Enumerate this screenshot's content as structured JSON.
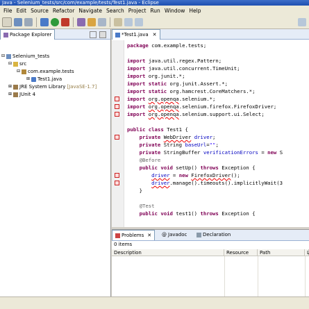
{
  "window": {
    "title": "Java - Selenium_tests/src/com/example/tests/Test1.java - Eclipse"
  },
  "menu": [
    "File",
    "Edit",
    "Source",
    "Refactor",
    "Navigate",
    "Search",
    "Project",
    "Run",
    "Window",
    "Help"
  ],
  "package_explorer": {
    "tab_label": "Package Explorer",
    "tree": [
      {
        "label": "Selenium_tests"
      },
      {
        "label": "src"
      },
      {
        "label": "com.example.tests"
      },
      {
        "label": "Test1.java"
      },
      {
        "label": "JRE System Library",
        "extra": "[JavaSE-1.7]"
      },
      {
        "label": "JUnit 4"
      }
    ]
  },
  "editor": {
    "tab_label": "*Test1.java",
    "lines": [
      [
        {
          "t": "package",
          "c": "kw"
        },
        {
          "t": " com.example.tests;"
        }
      ],
      [],
      [
        {
          "t": "import",
          "c": "kw"
        },
        {
          "t": " java.util.regex.Pattern;"
        }
      ],
      [
        {
          "t": "import",
          "c": "kw"
        },
        {
          "t": " java.util.concurrent.TimeUnit;"
        }
      ],
      [
        {
          "t": "import",
          "c": "kw"
        },
        {
          "t": " org.junit.*;"
        }
      ],
      [
        {
          "t": "import static",
          "c": "kw"
        },
        {
          "t": " org.junit.Assert.*;"
        }
      ],
      [
        {
          "t": "import static",
          "c": "kw"
        },
        {
          "t": " org.hamcrest.CoreMatchers.*;"
        }
      ],
      [
        {
          "t": "import",
          "c": "kw"
        },
        {
          "t": " "
        },
        {
          "t": "org.openqa",
          "c": "err"
        },
        {
          "t": ".selenium.*;"
        }
      ],
      [
        {
          "t": "import",
          "c": "kw"
        },
        {
          "t": " "
        },
        {
          "t": "org.openqa",
          "c": "err"
        },
        {
          "t": ".selenium.firefox.FirefoxDriver;"
        }
      ],
      [
        {
          "t": "import",
          "c": "kw"
        },
        {
          "t": " "
        },
        {
          "t": "org.openqa",
          "c": "err"
        },
        {
          "t": ".selenium.support.ui.Select;"
        }
      ],
      [],
      [
        {
          "t": "public class",
          "c": "kw"
        },
        {
          "t": " Test1 {"
        }
      ],
      [
        {
          "t": "    private",
          "c": "kw"
        },
        {
          "t": " "
        },
        {
          "t": "WebDriver",
          "c": "err"
        },
        {
          "t": " "
        },
        {
          "t": "driver",
          "c": "fld"
        },
        {
          "t": ";"
        }
      ],
      [
        {
          "t": "    private",
          "c": "kw"
        },
        {
          "t": " String "
        },
        {
          "t": "baseUrl",
          "c": "fld"
        },
        {
          "t": "="
        },
        {
          "t": "\"\"",
          "c": "str"
        },
        {
          "t": ";"
        }
      ],
      [
        {
          "t": "    private",
          "c": "kw"
        },
        {
          "t": " StringBuffer "
        },
        {
          "t": "verificationErrors",
          "c": "fld"
        },
        {
          "t": " = "
        },
        {
          "t": "new",
          "c": "kw"
        },
        {
          "t": " S"
        }
      ],
      [
        {
          "t": "    @Before",
          "c": "ann"
        }
      ],
      [
        {
          "t": "    public void",
          "c": "kw"
        },
        {
          "t": " setUp() "
        },
        {
          "t": "throws",
          "c": "kw"
        },
        {
          "t": " Exception {"
        }
      ],
      [
        {
          "t": "        "
        },
        {
          "t": "driver",
          "c": "fld err"
        },
        {
          "t": " = "
        },
        {
          "t": "new",
          "c": "kw"
        },
        {
          "t": " "
        },
        {
          "t": "FirefoxDriver",
          "c": "err"
        },
        {
          "t": "();"
        }
      ],
      [
        {
          "t": "        "
        },
        {
          "t": "driver",
          "c": "fld err"
        },
        {
          "t": ".manage().timeouts().implicitlyWait(3"
        }
      ],
      [
        {
          "t": "    }"
        }
      ],
      [],
      [
        {
          "t": "    @Test",
          "c": "ann"
        }
      ],
      [
        {
          "t": "    public void",
          "c": "kw"
        },
        {
          "t": " test1() "
        },
        {
          "t": "throws",
          "c": "kw"
        },
        {
          "t": " Exception {"
        }
      ]
    ],
    "error_marker_lines": [
      7,
      8,
      9,
      12,
      17,
      18
    ]
  },
  "bottom_panel": {
    "tabs": [
      "Problems",
      "Javadoc",
      "Declaration"
    ],
    "items_count": "0 items",
    "columns": [
      "Description",
      "Resource",
      "Path",
      "L"
    ]
  }
}
